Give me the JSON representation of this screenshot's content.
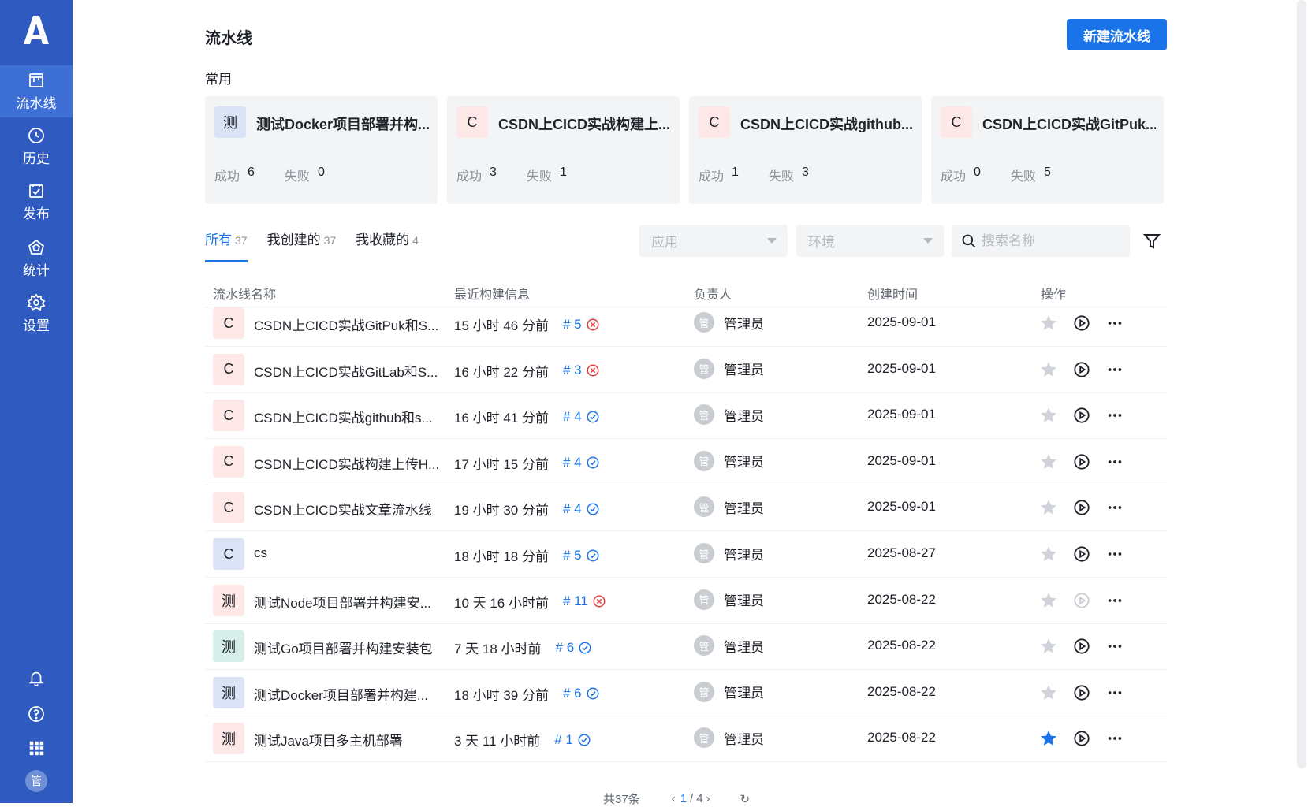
{
  "sidebar": {
    "logo": "A",
    "items": [
      {
        "label": "流水线",
        "icon": "pipeline-icon",
        "active": true
      },
      {
        "label": "历史",
        "icon": "clock-icon",
        "active": false
      },
      {
        "label": "发布",
        "icon": "calendar-check-icon",
        "active": false
      },
      {
        "label": "统计",
        "icon": "stats-icon",
        "active": false
      },
      {
        "label": "设置",
        "icon": "gear-icon",
        "active": false
      }
    ],
    "bottom": [
      "bell-icon",
      "help-icon",
      "apps-grid-icon"
    ],
    "user_avatar": "管"
  },
  "header": {
    "title": "流水线",
    "new_button": "新建流水线"
  },
  "favorites": {
    "label": "常用",
    "success_label": "成功",
    "fail_label": "失败",
    "cards": [
      {
        "avatar": "测",
        "name": "测试Docker项目部署并构...",
        "success": "6",
        "fail": "0",
        "color": "#dbe4f7"
      },
      {
        "avatar": "C",
        "name": "CSDN上CICD实战构建上...",
        "success": "3",
        "fail": "1",
        "color": "#fde7e7"
      },
      {
        "avatar": "C",
        "name": "CSDN上CICD实战github...",
        "success": "1",
        "fail": "3",
        "color": "#fde7e7"
      },
      {
        "avatar": "C",
        "name": "CSDN上CICD实战GitPuk...",
        "success": "0",
        "fail": "5",
        "color": "#fde7e7"
      }
    ]
  },
  "tabs": [
    {
      "label": "所有",
      "count": "37"
    },
    {
      "label": "我创建的",
      "count": "37"
    },
    {
      "label": "我收藏的",
      "count": "4"
    }
  ],
  "filters": {
    "app_placeholder": "应用",
    "env_placeholder": "环境",
    "search_placeholder": "搜索名称"
  },
  "table": {
    "headers": [
      "流水线名称",
      "最近构建信息",
      "负责人",
      "创建时间",
      "操作"
    ],
    "rows": [
      {
        "avatar": "C",
        "color": "#fde7e7",
        "name": "CSDN上CICD实战GitPuk和S...",
        "time": "15 小时 46 分前",
        "build": "# 5",
        "status": "fail",
        "owner": "管理员",
        "owner_avatar": "管",
        "date": "2025-09-01",
        "starred": false,
        "run_enabled": true
      },
      {
        "avatar": "C",
        "color": "#fde7e7",
        "name": "CSDN上CICD实战GitLab和S...",
        "time": "16 小时 22 分前",
        "build": "# 3",
        "status": "fail",
        "owner": "管理员",
        "owner_avatar": "管",
        "date": "2025-09-01",
        "starred": false,
        "run_enabled": true
      },
      {
        "avatar": "C",
        "color": "#fde7e7",
        "name": "CSDN上CICD实战github和s...",
        "time": "16 小时 41 分前",
        "build": "# 4",
        "status": "success",
        "owner": "管理员",
        "owner_avatar": "管",
        "date": "2025-09-01",
        "starred": false,
        "run_enabled": true
      },
      {
        "avatar": "C",
        "color": "#fde7e7",
        "name": "CSDN上CICD实战构建上传H...",
        "time": "17 小时 15 分前",
        "build": "# 4",
        "status": "success",
        "owner": "管理员",
        "owner_avatar": "管",
        "date": "2025-09-01",
        "starred": false,
        "run_enabled": true
      },
      {
        "avatar": "C",
        "color": "#fde7e7",
        "name": "CSDN上CICD实战文章流水线",
        "time": "19 小时 30 分前",
        "build": "# 4",
        "status": "success",
        "owner": "管理员",
        "owner_avatar": "管",
        "date": "2025-09-01",
        "starred": false,
        "run_enabled": true
      },
      {
        "avatar": "C",
        "color": "#dbe4f7",
        "name": "cs",
        "time": "18 小时 18 分前",
        "build": "# 5",
        "status": "success",
        "owner": "管理员",
        "owner_avatar": "管",
        "date": "2025-08-27",
        "starred": false,
        "run_enabled": true
      },
      {
        "avatar": "测",
        "color": "#fde7e7",
        "name": "测试Node项目部署并构建安...",
        "time": "10 天 16 小时前",
        "build": "# 11",
        "status": "fail",
        "owner": "管理员",
        "owner_avatar": "管",
        "date": "2025-08-22",
        "starred": false,
        "run_enabled": false
      },
      {
        "avatar": "测",
        "color": "#d6efe9",
        "name": "测试Go项目部署并构建安装包",
        "time": "7 天 18 小时前",
        "build": "# 6",
        "status": "success",
        "owner": "管理员",
        "owner_avatar": "管",
        "date": "2025-08-22",
        "starred": false,
        "run_enabled": true
      },
      {
        "avatar": "测",
        "color": "#dbe4f7",
        "name": "测试Docker项目部署并构建...",
        "time": "18 小时 39 分前",
        "build": "# 6",
        "status": "success",
        "owner": "管理员",
        "owner_avatar": "管",
        "date": "2025-08-22",
        "starred": false,
        "run_enabled": true
      },
      {
        "avatar": "测",
        "color": "#fde7e7",
        "name": "测试Java项目多主机部署",
        "time": "3 天 11 小时前",
        "build": "# 1",
        "status": "success",
        "owner": "管理员",
        "owner_avatar": "管",
        "date": "2025-08-22",
        "starred": true,
        "run_enabled": true
      }
    ]
  },
  "pager": {
    "total": "共37条",
    "current": "1",
    "sep": "/",
    "pages": "4"
  },
  "colors": {
    "sidebar": "#2f5bc0",
    "accent": "#1a73e8",
    "fail": "#e5393b",
    "success": "#1a73e8",
    "star_off": "#d0d3d9"
  }
}
